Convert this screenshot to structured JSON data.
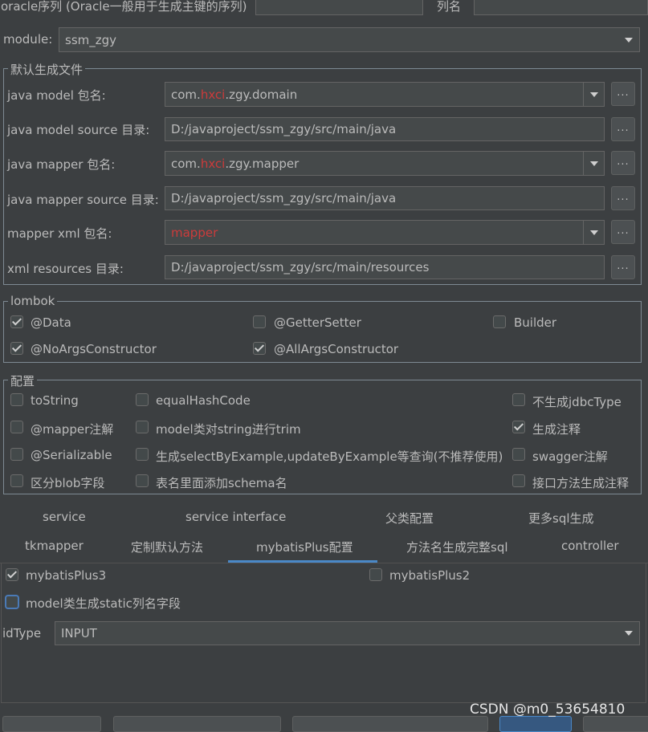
{
  "top": {
    "oracle_label": "oracle序列 (Oracle一般用于生成主键的序列)",
    "column_label": "列名",
    "oracle_value": "",
    "column_value": ""
  },
  "module": {
    "label": "module:",
    "value": "ssm_zgy"
  },
  "default_files": {
    "title": "默认生成文件",
    "rows": [
      {
        "label": "java model 包名:",
        "value_parts": [
          "com.",
          "hxci",
          ".zgy.domain"
        ]
      },
      {
        "label": "java model source 目录:",
        "value": "D:/javaproject/ssm_zgy/src/main/java"
      },
      {
        "label": "java mapper 包名:",
        "value_parts": [
          "com.",
          "hxci",
          ".zgy.mapper"
        ]
      },
      {
        "label": "java mapper source 目录:",
        "value": "D:/javaproject/ssm_zgy/src/main/java"
      },
      {
        "label": "mapper xml 包名:",
        "value": "mapper"
      },
      {
        "label": "xml resources 目录:",
        "value": "D:/javaproject/ssm_zgy/src/main/resources"
      }
    ],
    "browse_label": "..."
  },
  "lombok": {
    "title": "lombok",
    "items": [
      {
        "label": "@Data",
        "checked": true
      },
      {
        "label": "@GetterSetter",
        "checked": false
      },
      {
        "label": "Builder",
        "checked": false
      },
      {
        "label": "@NoArgsConstructor",
        "checked": true
      },
      {
        "label": "@AllArgsConstructor",
        "checked": true
      }
    ]
  },
  "config": {
    "title": "配置",
    "items": [
      {
        "label": "toString",
        "checked": false
      },
      {
        "label": "equalHashCode",
        "checked": false
      },
      {
        "label": "不生成jdbcType",
        "checked": false
      },
      {
        "label": "@mapper注解",
        "checked": false
      },
      {
        "label": "model类对string进行trim",
        "checked": false
      },
      {
        "label": "生成注释",
        "checked": true
      },
      {
        "label": "@Serializable",
        "checked": false
      },
      {
        "label": "生成selectByExample,updateByExample等查询(不推荐使用)",
        "checked": false
      },
      {
        "label": "swagger注解",
        "checked": false
      },
      {
        "label": "区分blob字段",
        "checked": false
      },
      {
        "label": "表名里面添加schema名",
        "checked": false
      },
      {
        "label": "接口方法生成注释",
        "checked": false
      }
    ]
  },
  "tabs": {
    "row1": [
      "service",
      "service interface",
      "父类配置",
      "更多sql生成"
    ],
    "row2": [
      "tkmapper",
      "定制默认方法",
      "mybatisPlus配置",
      "方法名生成完整sql",
      "controller"
    ],
    "selected": "mybatisPlus配置"
  },
  "mybatis_plus": {
    "items": [
      {
        "label": "mybatisPlus3",
        "checked": true
      },
      {
        "label": "mybatisPlus2",
        "checked": false
      },
      {
        "label": "model类生成static列名字段",
        "checked": false
      }
    ],
    "idtype_label": "idType",
    "idtype_value": "INPUT"
  },
  "watermark": "CSDN @m0_53654810",
  "colors": {
    "accent": "#4a88c7",
    "highlight_red": "#cc3b3b",
    "background": "#3c3f41"
  }
}
